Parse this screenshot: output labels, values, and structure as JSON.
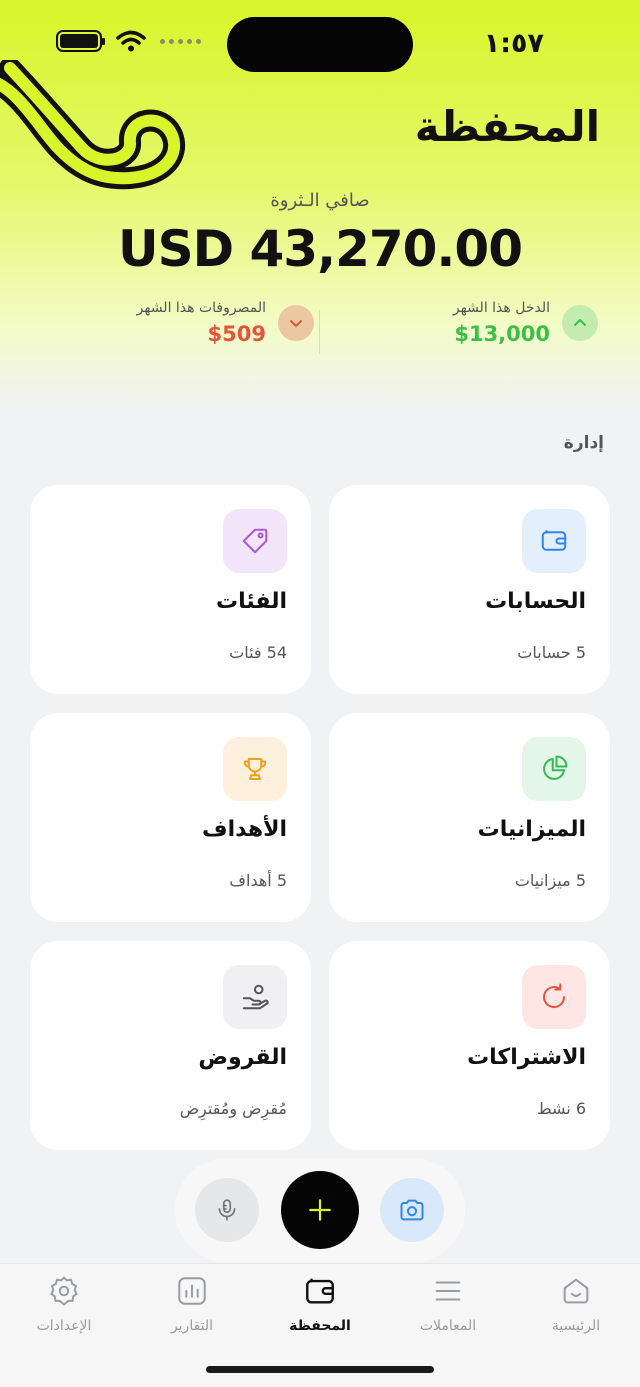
{
  "status_bar": {
    "time": "١:٥٧"
  },
  "header": {
    "title": "المحفظة",
    "net_worth_label": "صافي الـثروة",
    "net_worth_value": "USD 43,270.00"
  },
  "stats": {
    "income": {
      "label": "الدخل هذا الشهر",
      "value": "$13,000"
    },
    "expense": {
      "label": "المصروفات هذا الشهر",
      "value": "$509"
    }
  },
  "section": {
    "label": "إدارة"
  },
  "cards": {
    "accounts": {
      "title": "الحسابات",
      "subtitle": "5 حسابات",
      "icon": "wallet-icon",
      "color": "#2f86e6",
      "bg": "#e3effc"
    },
    "categories": {
      "title": "الفئات",
      "subtitle": "54 فئات",
      "icon": "tag-icon",
      "color": "#b055d4",
      "bg": "#f3e6fa"
    },
    "budgets": {
      "title": "الميزانيات",
      "subtitle": "5 ميزانيات",
      "icon": "pie-chart-icon",
      "color": "#35b955",
      "bg": "#e3f6e7"
    },
    "goals": {
      "title": "الأهداف",
      "subtitle": "5 أهداف",
      "icon": "trophy-icon",
      "color": "#f0a01e",
      "bg": "#fdf0dd"
    },
    "subscriptions": {
      "title": "الاشتراكات",
      "subtitle": "6 نشط",
      "icon": "refresh-icon",
      "color": "#e5543b",
      "bg": "#fde6e4"
    },
    "loans": {
      "title": "القروض",
      "subtitle": "مُقرِض ومُقترِض",
      "icon": "hand-coin-icon",
      "color": "#555",
      "bg": "#f0f0f2"
    }
  },
  "tabs": [
    {
      "label": "الرئيسية",
      "icon": "home-icon"
    },
    {
      "label": "المعاملات",
      "icon": "list-icon"
    },
    {
      "label": "المحفظة",
      "icon": "wallet-icon",
      "active": true
    },
    {
      "label": "التقارير",
      "icon": "chart-icon"
    },
    {
      "label": "الإعدادات",
      "icon": "gear-icon"
    }
  ],
  "colors": {
    "accent": "#d7f52a",
    "income": "#3cbf48",
    "expense": "#e5543b"
  }
}
